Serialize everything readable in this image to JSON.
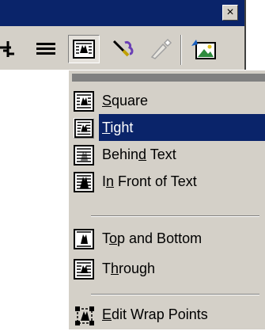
{
  "toolbar": {
    "close_glyph": "×",
    "buttons": [
      {
        "name": "crop",
        "icon": "crop-icon"
      },
      {
        "name": "line-style",
        "icon": "line-style-icon"
      },
      {
        "name": "text-wrapping",
        "icon": "text-wrapping-icon",
        "pressed": true
      },
      {
        "name": "format-picture",
        "icon": "format-picture-icon"
      },
      {
        "name": "set-transparent-color",
        "icon": "set-transparent-color-icon",
        "disabled": true
      },
      {
        "name": "reset-picture",
        "icon": "reset-picture-icon"
      }
    ]
  },
  "menu": {
    "items": [
      {
        "pre": "",
        "acc": "S",
        "post": "quare",
        "icon": "wrap-square-icon"
      },
      {
        "pre": "",
        "acc": "T",
        "post": "ight",
        "icon": "wrap-tight-icon",
        "selected": true
      },
      {
        "pre": "Behin",
        "acc": "d",
        "post": " Text",
        "icon": "wrap-behind-text-icon"
      },
      {
        "pre": "I",
        "acc": "n",
        "post": " Front of Text",
        "icon": "wrap-in-front-icon"
      },
      {
        "pre": "T",
        "acc": "o",
        "post": "p and Bottom",
        "icon": "wrap-top-bottom-icon"
      },
      {
        "pre": "T",
        "acc": "h",
        "post": "rough",
        "icon": "wrap-through-icon"
      },
      {
        "pre": "",
        "acc": "E",
        "post": "dit Wrap Points",
        "icon": "edit-wrap-points-icon"
      }
    ]
  },
  "colors": {
    "title_bar": "#0a246a",
    "face": "#d4d0c8",
    "highlight": "#0a246a"
  }
}
